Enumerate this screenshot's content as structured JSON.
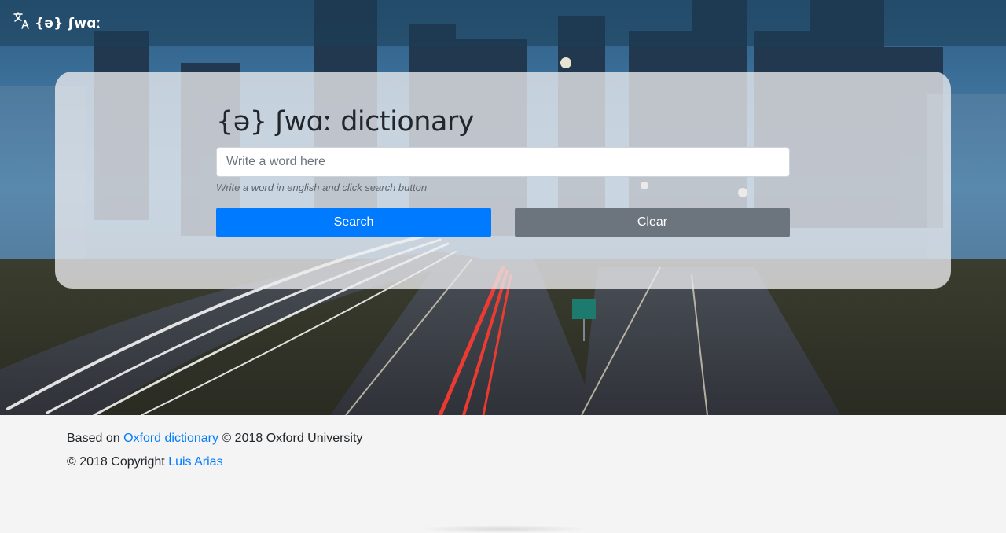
{
  "navbar": {
    "brand_text": "{ə} ʃwɑː",
    "brand_icon": "translate-icon"
  },
  "search_panel": {
    "title": "{ə} ʃwɑː dictionary",
    "input_placeholder": "Write a word here",
    "input_value": "",
    "helper_text": "Write a word in english and click search button",
    "search_label": "Search",
    "clear_label": "Clear"
  },
  "footer": {
    "line1_prefix": "Based on ",
    "line1_link": "Oxford dictionary",
    "line1_suffix": " © 2018 Oxford University",
    "line2_prefix": "© 2018 Copyright ",
    "line2_link": "Luis Arias"
  },
  "colors": {
    "primary": "#007bff",
    "secondary": "#6c757d",
    "footer_bg": "#f4f4f4",
    "text": "#212529"
  }
}
